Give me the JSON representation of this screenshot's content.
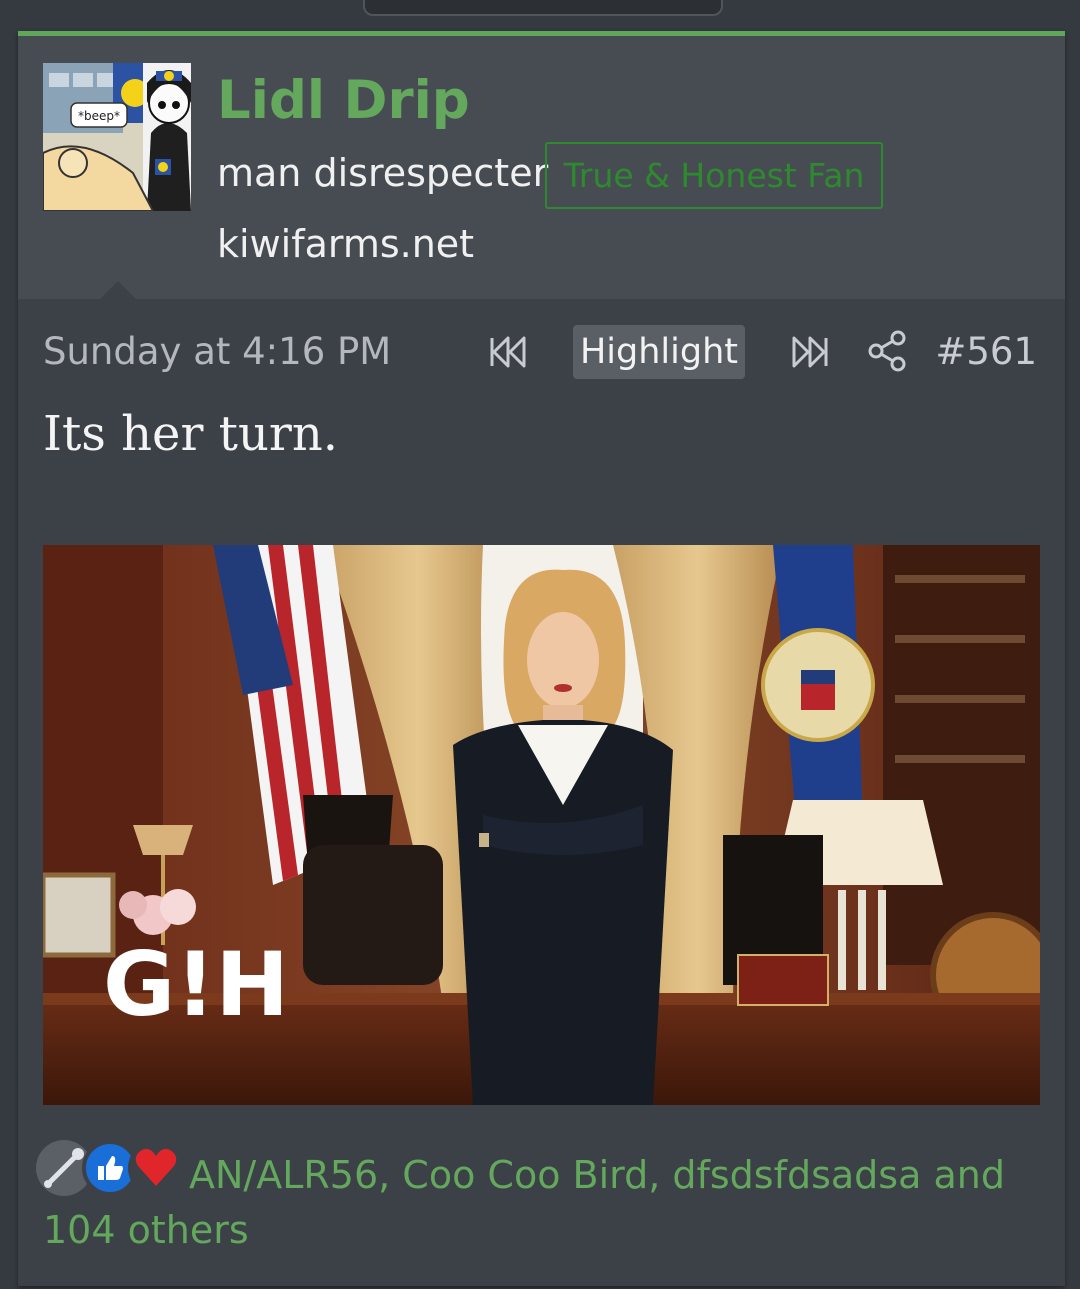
{
  "post": {
    "username": "Lidl Drip",
    "user_title": "man disrespecter",
    "user_banner": "True & Honest Fan",
    "user_site": "kiwifarms.net",
    "avatar_caption": "*beep*",
    "date": "Sunday at 4:16 PM",
    "highlight_label": "Highlight",
    "post_number": "#561",
    "body_text": "Its her turn.",
    "image_watermark": "G!H",
    "reactions": {
      "icons": [
        "wrench-reaction-icon",
        "like-reaction-icon",
        "heart-reaction-icon"
      ],
      "summary": "AN/ALR56, Coo Coo Bird, dfsdsfdsadsa and 104 others"
    }
  },
  "colors": {
    "accent": "#63a85c",
    "banner": "#2e8a2e",
    "card": "#3c4047",
    "header": "#474c53",
    "page": "#353a40"
  }
}
